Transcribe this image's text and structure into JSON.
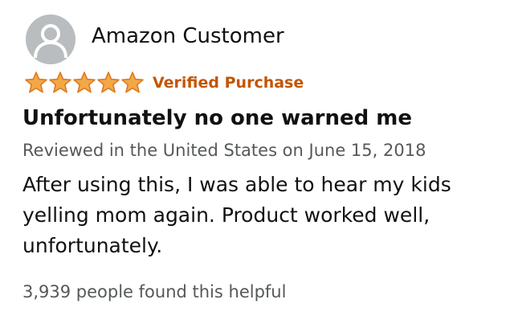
{
  "reviewer": {
    "name": "Amazon Customer",
    "avatar_icon": "user-silhouette-icon"
  },
  "rating": {
    "stars": 5,
    "max_stars": 5,
    "star_color": "#f3a847",
    "star_outline": "#de7921"
  },
  "badge": {
    "verified_label": "Verified Purchase",
    "color": "#c45500"
  },
  "review": {
    "title": "Unfortunately no one warned me",
    "meta": "Reviewed in the United States on June 15, 2018",
    "body_lines": [
      "After using this, I was able to hear my kids",
      "yelling mom again. Product worked well,",
      "unfortunately."
    ]
  },
  "helpful": {
    "text": "3,939 people found this helpful"
  }
}
